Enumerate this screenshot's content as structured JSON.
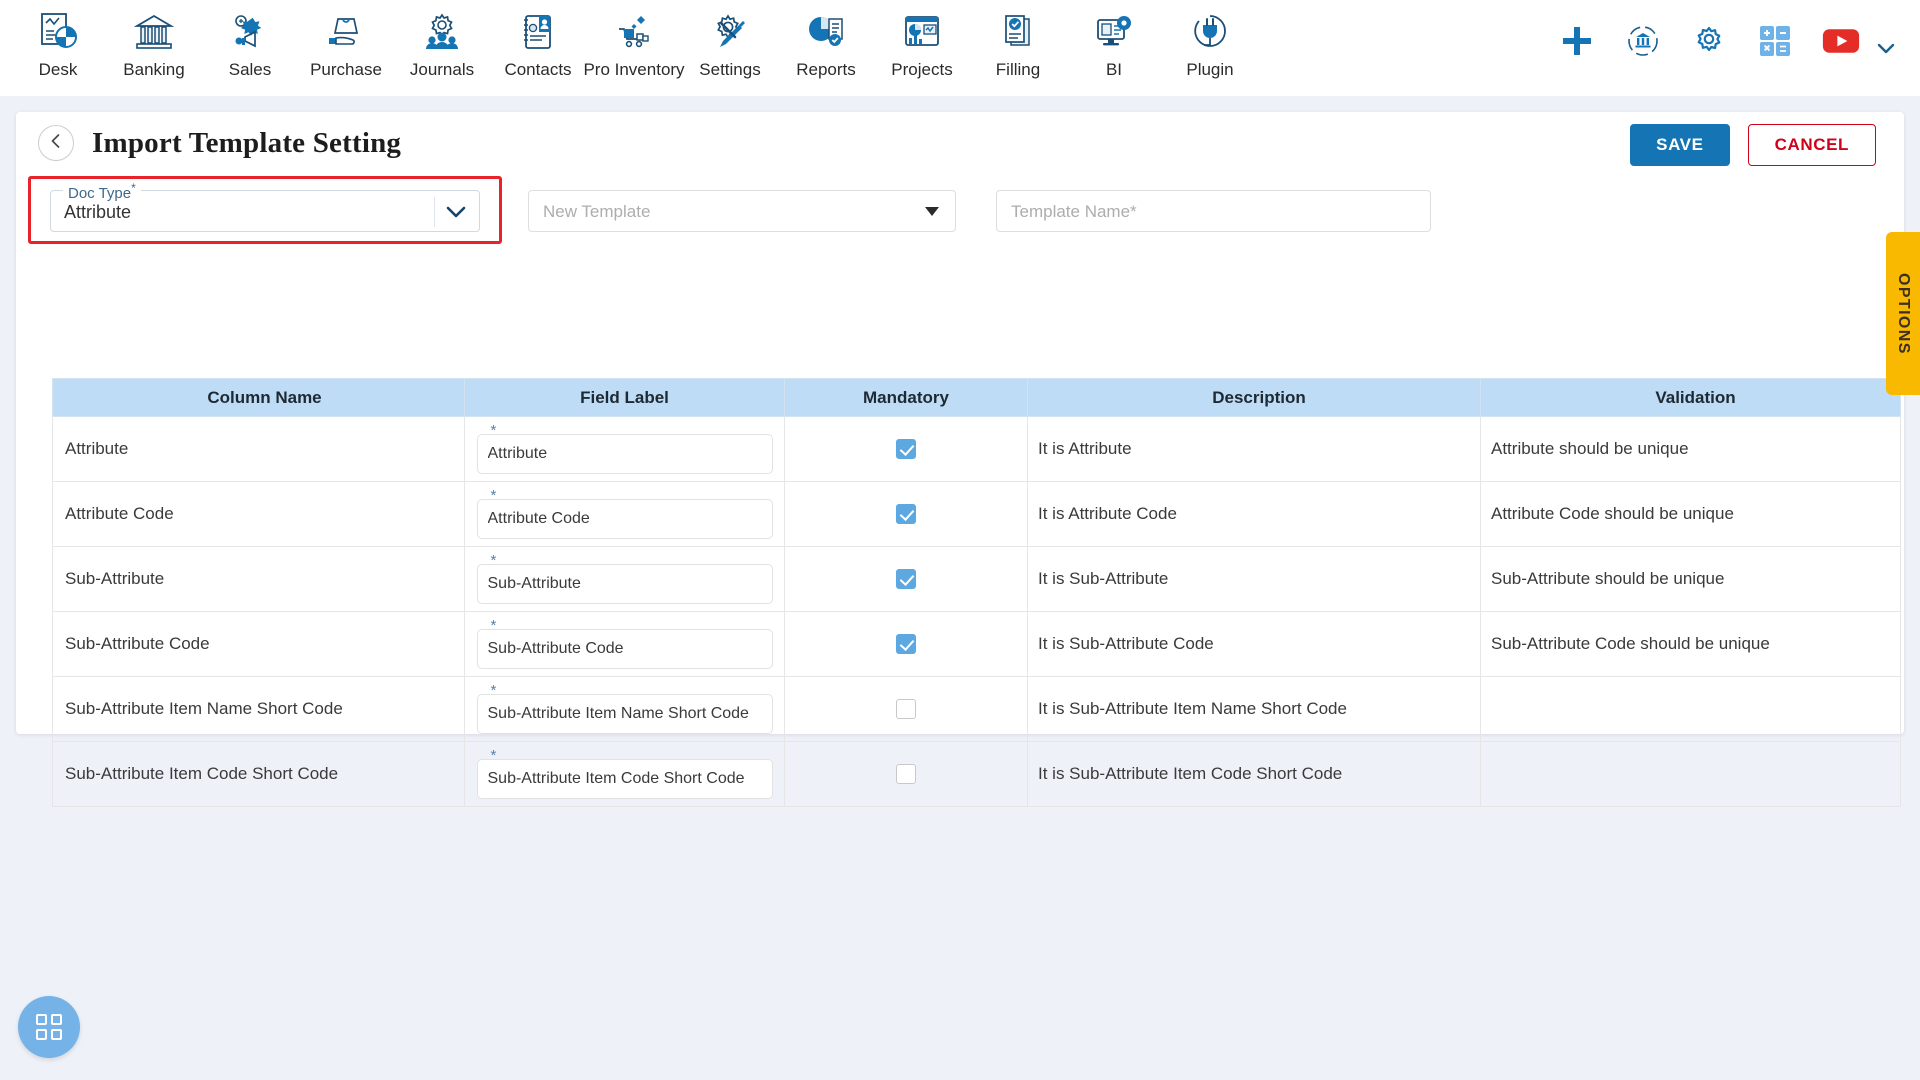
{
  "topnav": {
    "items": [
      {
        "label": "Desk",
        "icon": "desk-chart-icon"
      },
      {
        "label": "Banking",
        "icon": "bank-building-icon"
      },
      {
        "label": "Sales",
        "icon": "sales-megaphone-icon"
      },
      {
        "label": "Purchase",
        "icon": "purchase-bag-hand-icon"
      },
      {
        "label": "Journals",
        "icon": "journals-gear-people-icon"
      },
      {
        "label": "Contacts",
        "icon": "contacts-address-book-icon"
      },
      {
        "label": "Pro Inventory",
        "icon": "inventory-cart-icon"
      },
      {
        "label": "Settings",
        "icon": "settings-gear-wrench-icon"
      },
      {
        "label": "Reports",
        "icon": "reports-pie-doc-icon"
      },
      {
        "label": "Projects",
        "icon": "projects-dashboard-icon"
      },
      {
        "label": "Filling",
        "icon": "filling-check-docs-icon"
      },
      {
        "label": "BI",
        "icon": "bi-monitor-gear-icon"
      },
      {
        "label": "Plugin",
        "icon": "plugin-plug-icon"
      }
    ],
    "right_icons": [
      {
        "name": "add-plus-icon"
      },
      {
        "name": "bank-sync-icon"
      },
      {
        "name": "settings-gear-icon"
      },
      {
        "name": "calculator-icon"
      },
      {
        "name": "youtube-icon"
      }
    ],
    "collapse_icon": "chevron-down-icon"
  },
  "page": {
    "back_icon": "chevron-left-icon",
    "title": "Import Template Setting",
    "save_label": "SAVE",
    "cancel_label": "CANCEL"
  },
  "form": {
    "doc_type": {
      "legend": "Doc Type",
      "required_mark": "*",
      "value": "Attribute",
      "caret_icon": "chevron-down-icon",
      "highlight_color": "#e8232a"
    },
    "template_select": {
      "placeholder": "New Template",
      "caret_icon": "triangle-down-icon"
    },
    "template_name": {
      "placeholder": "Template Name*"
    }
  },
  "table": {
    "headers": [
      "Column Name",
      "Field Label",
      "Mandatory",
      "Description",
      "Validation"
    ],
    "rows": [
      {
        "column_name": "Attribute",
        "field_label": "Attribute",
        "required_mark": "*",
        "mandatory": true,
        "description": "It is Attribute",
        "validation": "Attribute should be unique"
      },
      {
        "column_name": "Attribute Code",
        "field_label": "Attribute Code",
        "required_mark": "*",
        "mandatory": true,
        "description": "It is Attribute Code",
        "validation": "Attribute Code should be unique"
      },
      {
        "column_name": "Sub-Attribute",
        "field_label": "Sub-Attribute",
        "required_mark": "*",
        "mandatory": true,
        "description": "It is Sub-Attribute",
        "validation": "Sub-Attribute should be unique"
      },
      {
        "column_name": "Sub-Attribute Code",
        "field_label": "Sub-Attribute Code",
        "required_mark": "*",
        "mandatory": true,
        "description": "It is Sub-Attribute Code",
        "validation": "Sub-Attribute Code should be unique"
      },
      {
        "column_name": "Sub-Attribute Item Name Short Code",
        "field_label": "Sub-Attribute Item Name Short Code",
        "required_mark": "*",
        "mandatory": false,
        "description": "It is Sub-Attribute Item Name Short Code",
        "validation": ""
      },
      {
        "column_name": "Sub-Attribute Item Code Short Code",
        "field_label": "Sub-Attribute Item Code Short Code",
        "required_mark": "*",
        "mandatory": false,
        "description": "It is Sub-Attribute Item Code Short Code",
        "validation": ""
      }
    ]
  },
  "options_tab": {
    "label": "OPTIONS",
    "color": "#f8b900"
  },
  "fab": {
    "icon": "grid-apps-icon",
    "color": "#74b2e8"
  },
  "theme": {
    "primary": "#1474b4",
    "danger": "#d0021b",
    "table_header_bg": "#bedcf5",
    "page_bg": "#eef2f8"
  }
}
